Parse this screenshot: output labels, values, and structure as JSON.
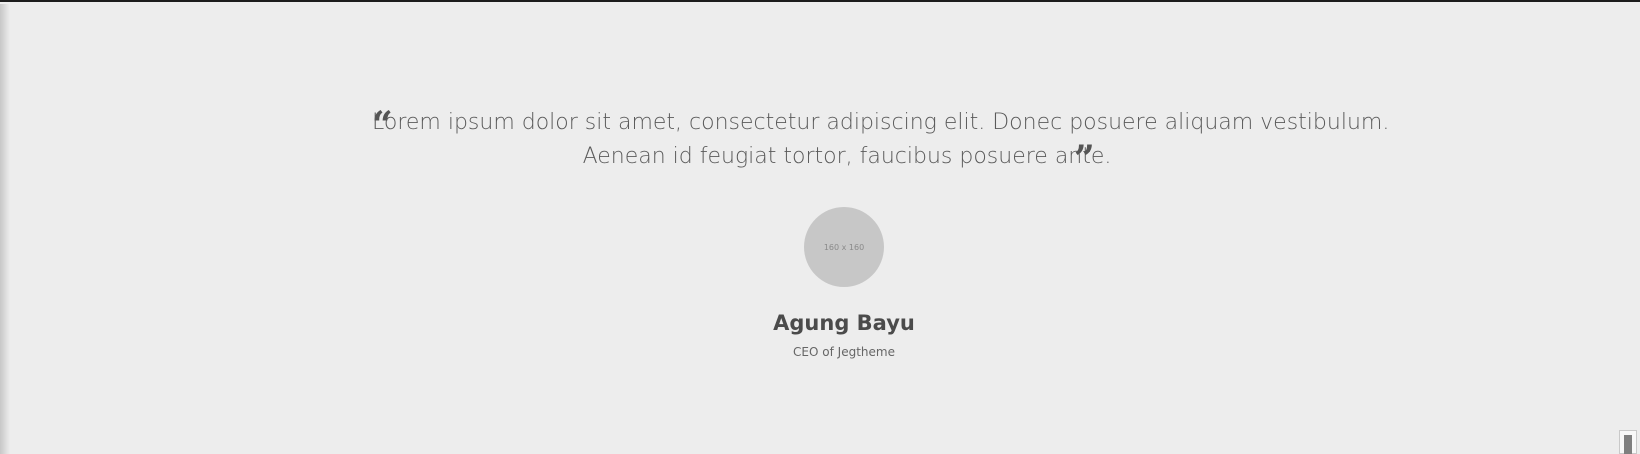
{
  "testimonial": {
    "quote_open": "“",
    "quote_line_1": "Lorem ipsum dolor sit amet, consectetur adipiscing elit. Donec posuere aliquam vestibulum.",
    "quote_line_2": "Aenean id feugiat tortor, faucibus posuere ante.",
    "quote_close": "”",
    "avatar_label": "160 x 160",
    "name": "Agung Bayu",
    "role": "CEO of Jegtheme"
  },
  "colors": {
    "background": "#ededed",
    "text": "#5a5a5a",
    "name": "#4b4b4b",
    "avatar": "#c7c7c7"
  },
  "icons": {
    "quote_open": "quote-open-icon",
    "quote_close": "quote-close-icon",
    "corner": "scroll-handle-icon"
  }
}
